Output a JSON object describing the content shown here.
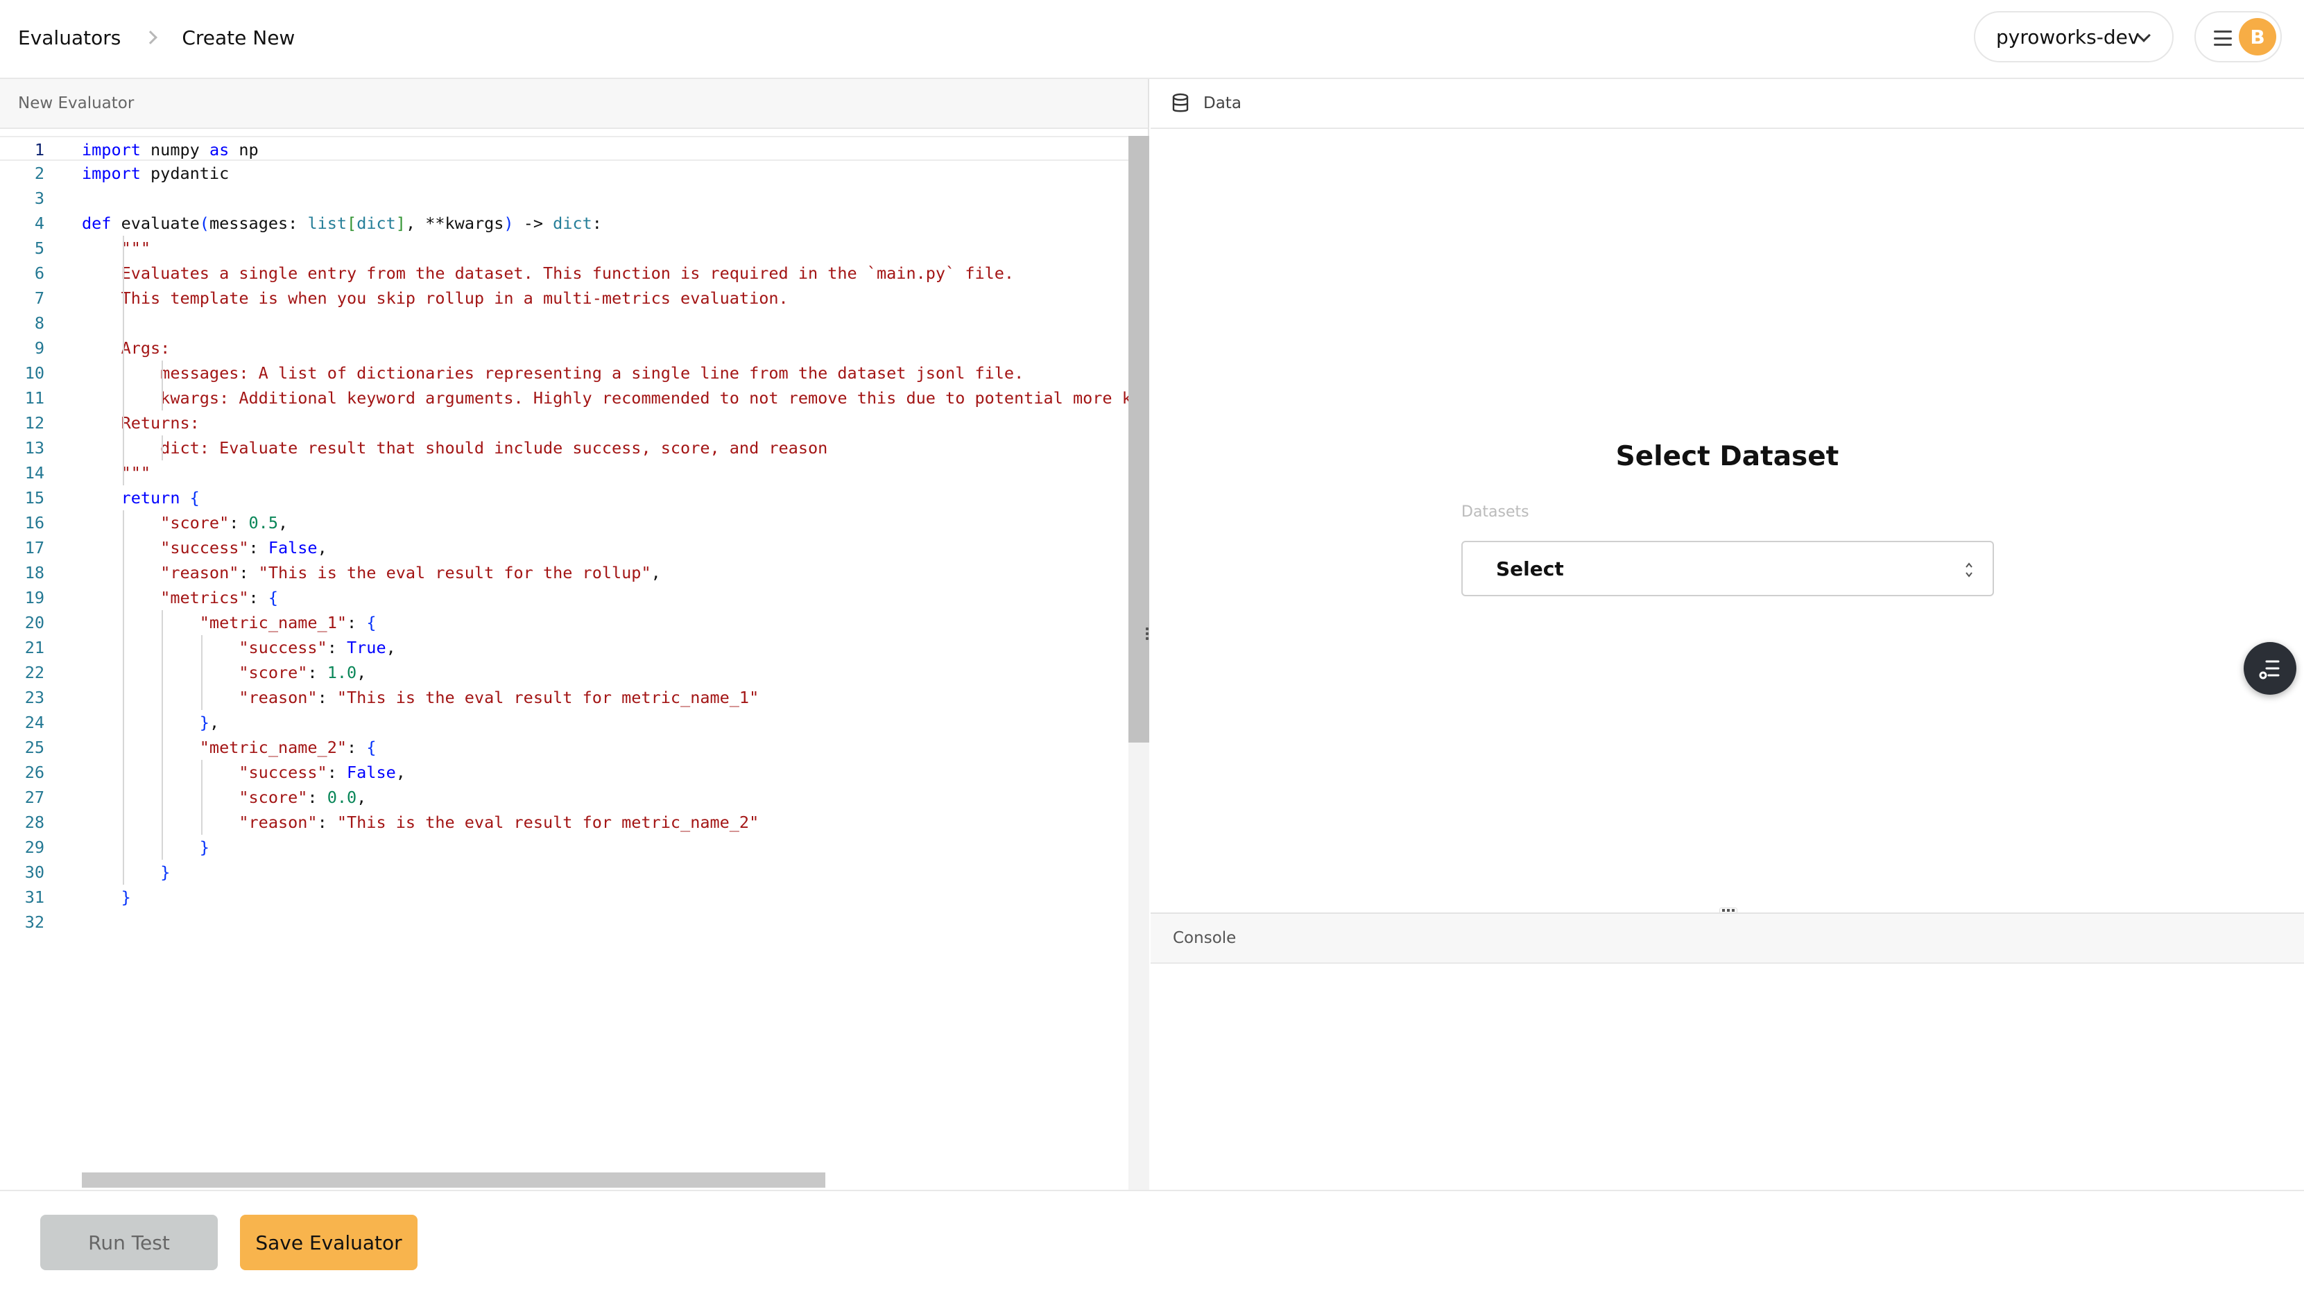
{
  "header": {
    "breadcrumb": [
      "Evaluators",
      "Create New"
    ],
    "project": "pyroworks-dev",
    "avatar_initial": "B"
  },
  "editor": {
    "title": "New Evaluator",
    "current_line": 1,
    "lines": [
      "import numpy as np",
      "import pydantic",
      "",
      "def evaluate(messages: list[dict], **kwargs) -> dict:",
      "    \"\"\"",
      "    Evaluates a single entry from the dataset. This function is required in the `main.py` file.",
      "    This template is when you skip rollup in a multi-metrics evaluation.",
      "",
      "    Args:",
      "        messages: A list of dictionaries representing a single line from the dataset jsonl file.",
      "        kwargs: Additional keyword arguments. Highly recommended to not remove this due to potential more k",
      "    Returns:",
      "        dict: Evaluate result that should include success, score, and reason",
      "    \"\"\"",
      "    return {",
      "        \"score\": 0.5,",
      "        \"success\": False,",
      "        \"reason\": \"This is the eval result for the rollup\",",
      "        \"metrics\": {",
      "            \"metric_name_1\": {",
      "                \"success\": True,",
      "                \"score\": 1.0,",
      "                \"reason\": \"This is the eval result for metric_name_1\"",
      "            },",
      "            \"metric_name_2\": {",
      "                \"success\": False,",
      "                \"score\": 0.0,",
      "                \"reason\": \"This is the eval result for metric_name_2\"",
      "            }",
      "        }",
      "    }",
      ""
    ]
  },
  "data_panel": {
    "title": "Data",
    "heading": "Select Dataset",
    "datasets_label": "Datasets",
    "select_value": "Select"
  },
  "console": {
    "title": "Console"
  },
  "footer": {
    "run_label": "Run Test",
    "save_label": "Save Evaluator"
  },
  "icons": {
    "breadcrumb_separator": "chevron-right-icon",
    "project_dropdown": "chevron-down-icon",
    "menu": "hamburger-icon",
    "data": "database-icon",
    "dataset_select": "up-down-chevron-icon",
    "fab": "filter-list-icon"
  },
  "colors": {
    "accent": "#f8b44d",
    "avatar": "#f7ad45",
    "keyword": "#0000ff",
    "string": "#a31515",
    "number": "#098658"
  }
}
